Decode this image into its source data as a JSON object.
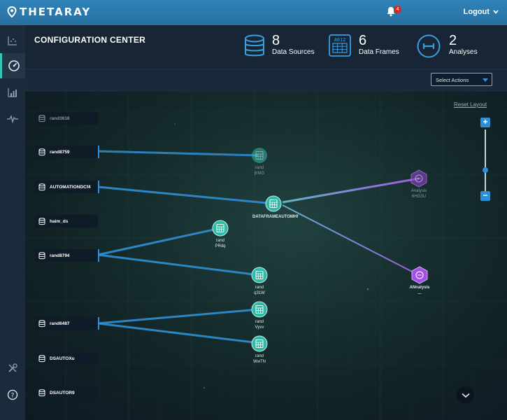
{
  "app": {
    "brand": "THETARAY"
  },
  "topbar": {
    "notification_count": "4",
    "logout_label": "Logout"
  },
  "sidebar": {
    "items": [
      {
        "icon": "scatter-chart-icon"
      },
      {
        "icon": "dashboard-gauge-icon",
        "active": true
      },
      {
        "icon": "bar-chart-icon"
      },
      {
        "icon": "pulse-wave-icon"
      },
      {
        "icon": "tools-icon"
      },
      {
        "icon": "help-icon"
      }
    ]
  },
  "header": {
    "title": "CONFIGURATION CENTER",
    "stats": [
      {
        "value": "8",
        "label": "Data Sources",
        "icon": "database-icon"
      },
      {
        "value": "6",
        "label": "Data Frames",
        "icon": "data-frame-icon",
        "icon_text": "A012"
      },
      {
        "value": "2",
        "label": "Analyses",
        "icon": "analysis-icon"
      }
    ]
  },
  "toolbar": {
    "select_actions": "Select Actions"
  },
  "canvas": {
    "reset_layout": "Reset Layout",
    "zoom_in": "+",
    "zoom_out": "−",
    "zoom_level": 0.45,
    "sources": [
      {
        "name": "rand3618",
        "connected": false
      },
      {
        "name": "rand8759",
        "connected": true
      },
      {
        "name": "AUTOMATIONDCf4",
        "connected": true
      },
      {
        "name": "haim_ds",
        "connected": false
      },
      {
        "name": "rand8794",
        "connected": true
      },
      {
        "name": "rand6487",
        "connected": true
      },
      {
        "name": "DSAUTOXu",
        "connected": false
      },
      {
        "name": "DSAUTOR9",
        "connected": false
      }
    ],
    "frames": [
      {
        "line1": "rand",
        "line2": "jhMG",
        "dim": true
      },
      {
        "line1": "DATAFRAMEAUTOMHf",
        "line2": "",
        "dim": false
      },
      {
        "line1": "rand",
        "line2": "PRdq",
        "dim": false
      },
      {
        "line1": "rand",
        "line2": "q31W",
        "dim": false
      },
      {
        "line1": "rand",
        "line2": "Vyvv",
        "dim": false
      },
      {
        "line1": "rand",
        "line2": "WwTN",
        "dim": false
      }
    ],
    "analyses": [
      {
        "line1": "Analysis",
        "line2": "6HG3U",
        "dim": true
      },
      {
        "line1": "ANnalysis",
        "line2": "...",
        "dim": false
      }
    ],
    "colors": {
      "teal": "#2fb9a6",
      "blue": "#2f8fd6",
      "purple": "#a05ae0"
    }
  }
}
